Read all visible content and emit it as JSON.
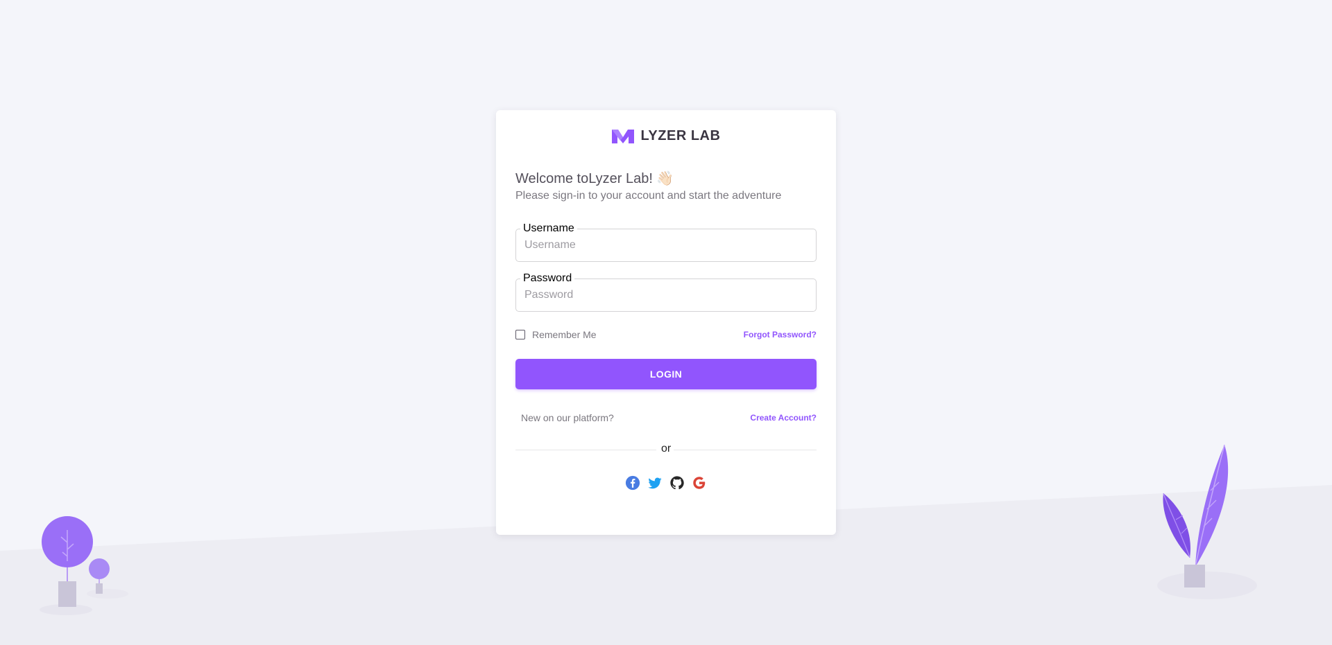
{
  "brand": {
    "name": "LYZER LAB",
    "logo_color": "#9155fd"
  },
  "welcome": {
    "title": "Welcome toLyzer Lab! 👋🏻",
    "subtitle": "Please sign-in to your account and start the adventure"
  },
  "form": {
    "username": {
      "label": "Username",
      "placeholder": "Username",
      "value": ""
    },
    "password": {
      "label": "Password",
      "placeholder": "Password",
      "value": ""
    },
    "remember_label": "Remember Me",
    "remember_checked": false,
    "forgot_label": "Forgot Password?",
    "login_label": "LOGIN"
  },
  "signup": {
    "prompt": "New on our platform?",
    "link_label": "Create Account?"
  },
  "divider_text": "or",
  "social": [
    {
      "name": "facebook",
      "icon": "facebook-icon",
      "color": "#497ce2"
    },
    {
      "name": "twitter",
      "icon": "twitter-icon",
      "color": "#1da1f2"
    },
    {
      "name": "github",
      "icon": "github-icon",
      "color": "#272727"
    },
    {
      "name": "google",
      "icon": "google-icon",
      "color": "#db4437"
    }
  ],
  "colors": {
    "primary": "#9155fd",
    "background": "#f4f5fa",
    "text": "#3a3541"
  }
}
